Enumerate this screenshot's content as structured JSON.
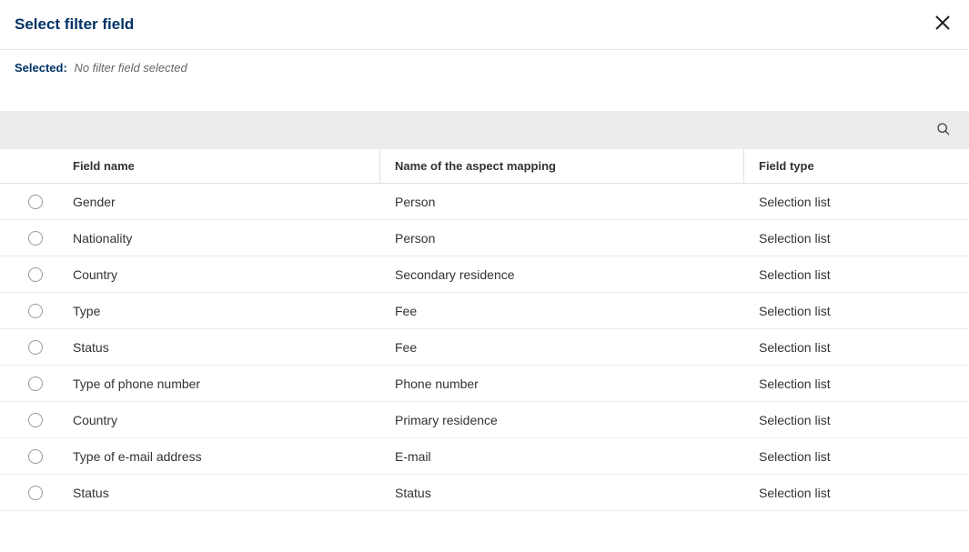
{
  "header": {
    "title": "Select filter field"
  },
  "selected": {
    "label": "Selected:",
    "value": "No filter field selected"
  },
  "columns": {
    "field_name": "Field name",
    "aspect_mapping": "Name of the aspect mapping",
    "field_type": "Field type"
  },
  "rows": [
    {
      "field_name": "Gender",
      "aspect_mapping": "Person",
      "field_type": "Selection list"
    },
    {
      "field_name": "Nationality",
      "aspect_mapping": "Person",
      "field_type": "Selection list"
    },
    {
      "field_name": "Country",
      "aspect_mapping": "Secondary residence",
      "field_type": "Selection list"
    },
    {
      "field_name": "Type",
      "aspect_mapping": "Fee",
      "field_type": "Selection list"
    },
    {
      "field_name": "Status",
      "aspect_mapping": "Fee",
      "field_type": "Selection list"
    },
    {
      "field_name": "Type of phone number",
      "aspect_mapping": "Phone number",
      "field_type": "Selection list"
    },
    {
      "field_name": "Country",
      "aspect_mapping": "Primary residence",
      "field_type": "Selection list"
    },
    {
      "field_name": "Type of e-mail address",
      "aspect_mapping": "E-mail",
      "field_type": "Selection list"
    },
    {
      "field_name": "Status",
      "aspect_mapping": "Status",
      "field_type": "Selection list"
    }
  ]
}
